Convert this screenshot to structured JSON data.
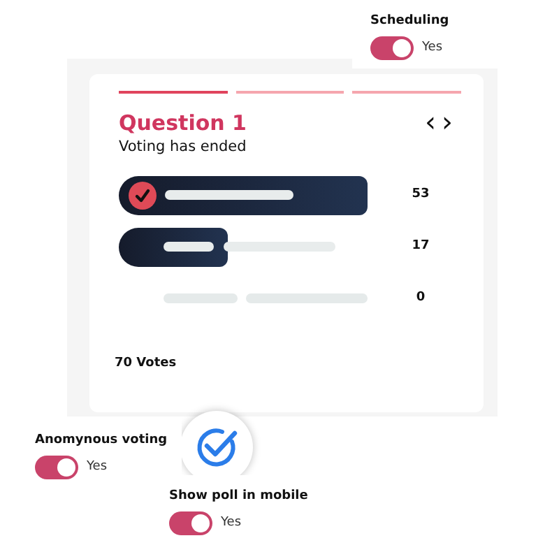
{
  "question": {
    "steps": [
      {
        "selected": true
      },
      {
        "selected": false
      },
      {
        "selected": false
      }
    ],
    "title": "Question 1",
    "subtitle": "Voting has ended",
    "prev_icon": "‹",
    "next_icon": "›",
    "options": [
      {
        "voted": true,
        "kind": "full",
        "count": "53"
      },
      {
        "voted": false,
        "kind": "partial",
        "count": "17"
      },
      {
        "voted": false,
        "kind": "empty",
        "count": "0"
      }
    ],
    "total": "70 Votes"
  },
  "settings": [
    {
      "label": "Scheduling",
      "on": true,
      "value": "Yes"
    },
    {
      "label": "Anomynous voting",
      "on": true,
      "value": "Yes"
    },
    {
      "label": "Show poll in mobile",
      "on": true,
      "value": "Yes"
    }
  ]
}
